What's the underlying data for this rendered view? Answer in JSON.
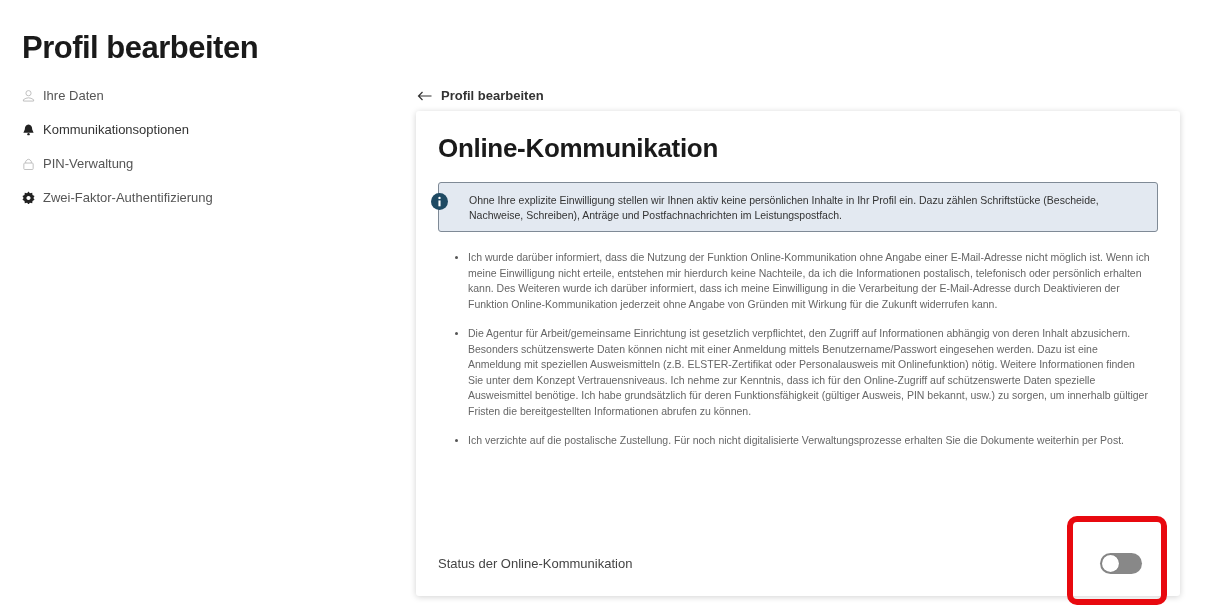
{
  "page_title": "Profil bearbeiten",
  "sidebar": {
    "items": [
      {
        "label": "Ihre Daten",
        "selected": false
      },
      {
        "label": "Kommunikationsoptionen",
        "selected": true
      },
      {
        "label": "PIN-Verwaltung",
        "selected": false
      },
      {
        "label": "Zwei-Faktor-Authentifizierung",
        "selected": false
      }
    ]
  },
  "back_link": {
    "label": "Profil bearbeiten"
  },
  "card": {
    "title": "Online-Kommunikation",
    "info": "Ohne Ihre explizite Einwilligung stellen wir Ihnen aktiv keine persönlichen Inhalte in Ihr Profil ein. Dazu zählen Schriftstücke (Bescheide, Nachweise, Schreiben), Anträge und Postfachnachrichten im Leistungspostfach.",
    "bullets": [
      "Ich wurde darüber informiert, dass die Nutzung der Funktion Online-Kommunikation ohne Angabe einer E-Mail-Adresse nicht möglich ist. Wenn ich meine Einwilligung nicht erteile, entstehen mir hierdurch keine Nachteile, da ich die Informationen postalisch, telefonisch oder persönlich erhalten kann. Des Weiteren wurde ich darüber informiert, dass ich meine Einwilligung in die Verarbeitung der E-Mail-Adresse durch Deaktivieren der Funktion Online-Kommunikation jederzeit ohne Angabe von Gründen mit Wirkung für die Zukunft widerrufen kann.",
      "Die Agentur für Arbeit/gemeinsame Einrichtung ist gesetzlich verpflichtet, den Zugriff auf Informationen abhängig von deren Inhalt abzusichern. Besonders schützenswerte Daten können nicht mit einer Anmeldung mittels Benutzername/Passwort eingesehen werden. Dazu ist eine Anmeldung mit speziellen Ausweismitteln (z.B. ELSTER-Zertifikat oder Personalausweis mit Onlinefunktion) nötig. Weitere Informationen finden Sie unter dem Konzept Vertrauensniveaus. Ich nehme zur Kenntnis, dass ich für den Online-Zugriff auf schützenswerte Daten spezielle Ausweismittel benötige. Ich habe grundsätzlich für deren Funktionsfähigkeit (gültiger Ausweis, PIN bekannt, usw.) zu sorgen, um innerhalb gültiger Fristen die bereitgestellten Informationen abrufen zu können.",
      "Ich verzichte auf die postalische Zustellung. Für noch nicht digitalisierte Verwaltungsprozesse erhalten Sie die Dokumente weiterhin per Post."
    ],
    "status": {
      "label": "Status der Online-Kommunikation",
      "on": false,
      "highlighted": true
    }
  }
}
